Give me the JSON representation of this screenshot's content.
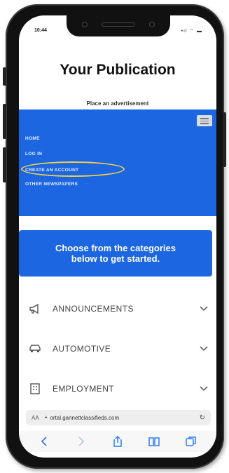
{
  "status_bar": {
    "time": "10:44",
    "indicators": "•ıl ⌔ ▬"
  },
  "site": {
    "title": "Your Publication",
    "subtitle": "Place an advertisement"
  },
  "nav": {
    "links": [
      "HOME",
      "LOG IN",
      "CREATE AN ACCOUNT",
      "OTHER NEWSPAPERS"
    ],
    "highlighted": "CREATE AN ACCOUNT"
  },
  "cta": {
    "line1": "Choose from the categories",
    "line2": "below to get started."
  },
  "categories": [
    {
      "label": "ANNOUNCEMENTS",
      "icon": "megaphone-icon"
    },
    {
      "label": "AUTOMOTIVE",
      "icon": "car-icon"
    },
    {
      "label": "EMPLOYMENT",
      "icon": "building-icon"
    }
  ],
  "browser": {
    "text_size": "AA",
    "url": "ortal.gannettclassifieds.com"
  },
  "colors": {
    "brand_blue": "#1c66e2",
    "highlight": "#f2d04a"
  }
}
